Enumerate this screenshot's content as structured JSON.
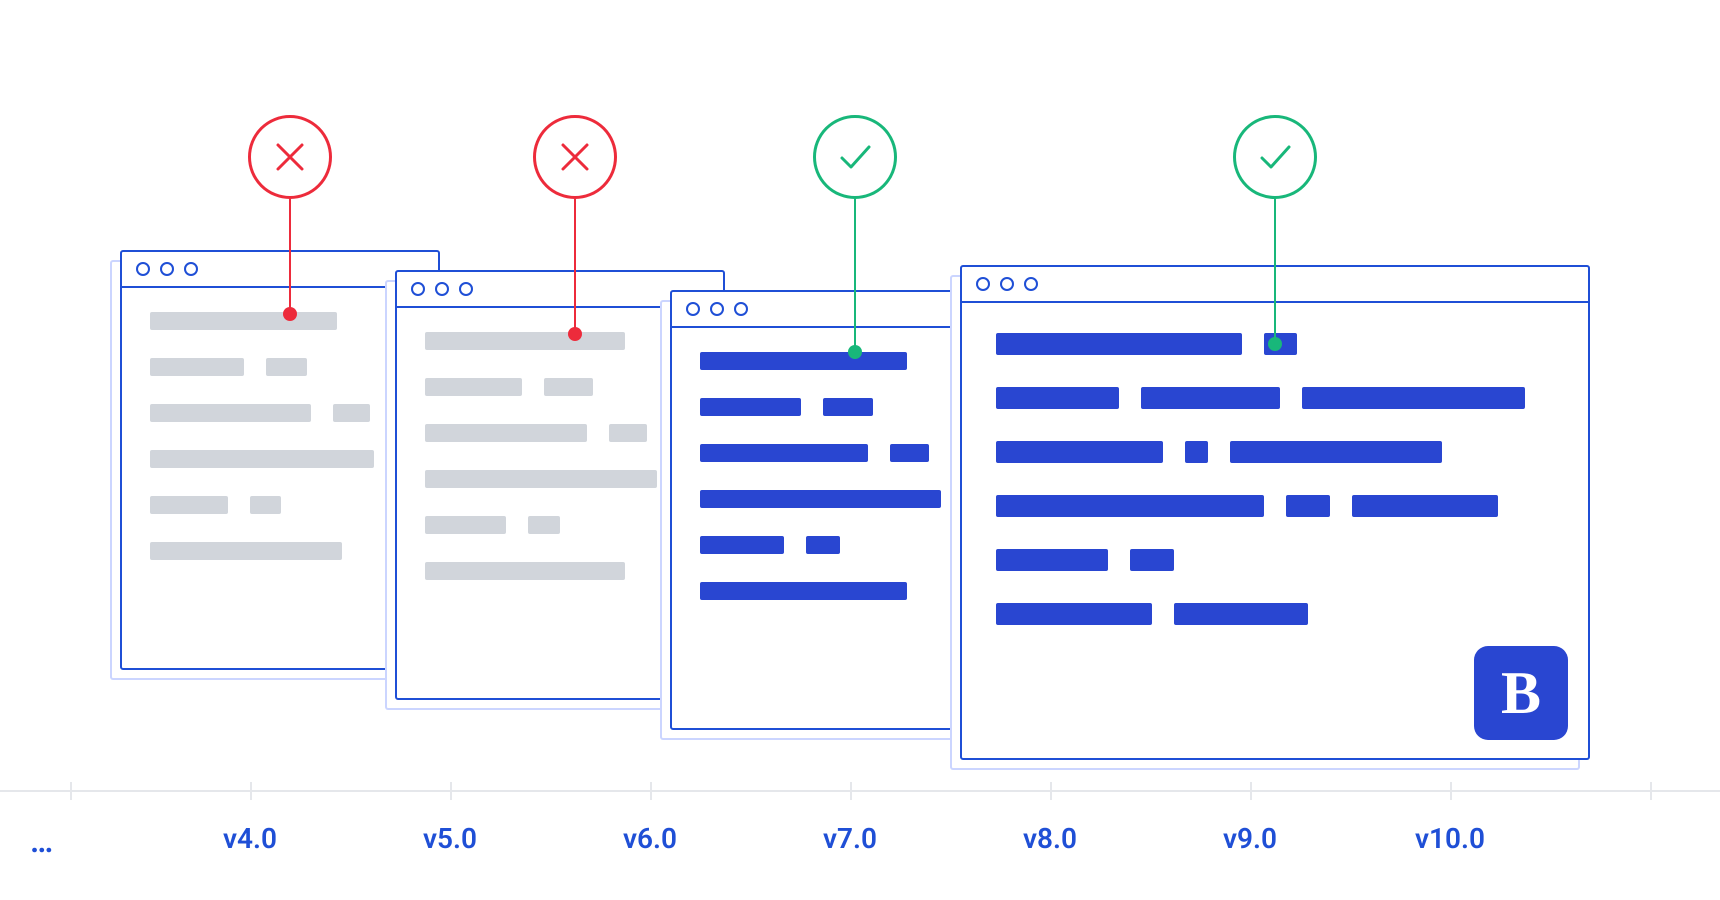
{
  "diagram": {
    "ellipsis": "…",
    "axis_ticks": [
      "v4.0",
      "v5.0",
      "v6.0",
      "v7.0",
      "v8.0",
      "v9.0",
      "v10.0"
    ],
    "badge_letter": "B",
    "windows": [
      {
        "id": 1,
        "status": "fail",
        "bar_color": "grey"
      },
      {
        "id": 2,
        "status": "fail",
        "bar_color": "grey"
      },
      {
        "id": 3,
        "status": "pass",
        "bar_color": "blue"
      },
      {
        "id": 4,
        "status": "pass",
        "bar_color": "blue",
        "has_badge": true
      }
    ],
    "colors": {
      "outline": "#1F4FD6",
      "fail": "#ED2B3B",
      "pass": "#18B77A",
      "bar_grey": "#D1D5DB",
      "bar_blue": "#2946D1",
      "axis": "#E5E7EB"
    }
  }
}
